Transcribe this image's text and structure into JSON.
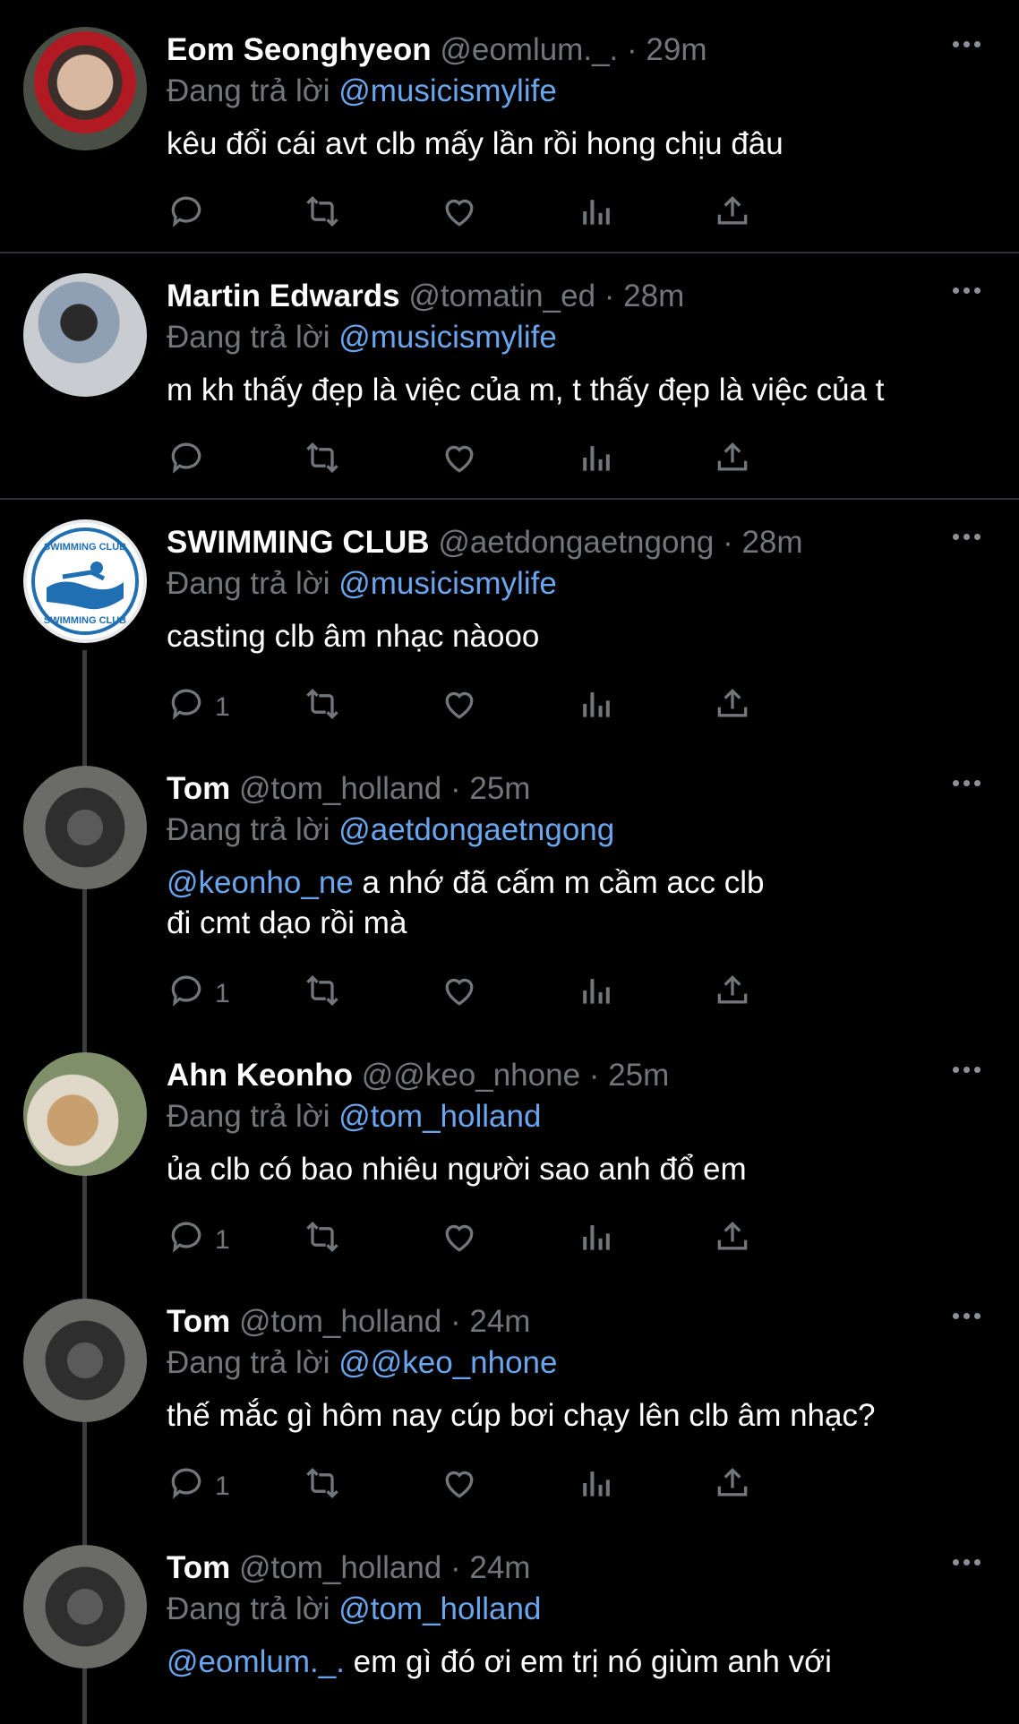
{
  "reply_prefix": "Đang trả lời",
  "tweets": [
    {
      "name": "Eom Seonghyeon",
      "handle": "@eomlum._.",
      "time": "29m",
      "reply_to": "@musicismylife",
      "body_mention": "",
      "body": "kêu đổi cái avt clb mấy lần rồi hong chịu đâu",
      "reply_count": ""
    },
    {
      "name": "Martin Edwards",
      "handle": "@tomatin_ed",
      "time": "28m",
      "reply_to": "@musicismylife",
      "body_mention": "",
      "body": "m kh thấy đẹp là việc của m, t thấy đẹp là việc của t",
      "reply_count": ""
    },
    {
      "name": "SWIMMING CLUB",
      "handle": "@aetdongaetngong",
      "time": "28m",
      "reply_to": "@musicismylife",
      "body_mention": "",
      "body": "casting clb âm nhạc nàooo",
      "reply_count": "1",
      "logo_text": "SWIMMING CLUB"
    },
    {
      "name": "Tom",
      "handle": "@tom_holland",
      "time": "25m",
      "reply_to": "@aetdongaetngong",
      "body_mention": "@keonho_ne",
      "body": " a nhớ đã cấm m cầm acc clb đi cmt dạo rồi mà",
      "reply_count": "1"
    },
    {
      "name": "Ahn Keonho",
      "handle": "@@keo_nhone",
      "time": "25m",
      "reply_to": "@tom_holland",
      "body_mention": "",
      "body": "ủa clb có bao nhiêu người sao anh đổ em",
      "reply_count": "1"
    },
    {
      "name": "Tom",
      "handle": "@tom_holland",
      "time": "24m",
      "reply_to": "@@keo_nhone",
      "body_mention": "",
      "body": "thế mắc gì hôm nay cúp bơi chạy lên clb âm nhạc?",
      "reply_count": "1"
    },
    {
      "name": "Tom",
      "handle": "@tom_holland",
      "time": "24m",
      "reply_to": "@tom_holland",
      "body_mention": "@eomlum._.",
      "body": " em gì đó ơi em trị nó giùm anh với",
      "reply_count": ""
    }
  ],
  "colors": {
    "background": "#000000",
    "text": "#e7e9ea",
    "muted": "#71767b",
    "link": "#6aa6ee",
    "divider": "#2f3336"
  },
  "icons": [
    "comment-icon",
    "retweet-icon",
    "like-icon",
    "views-icon",
    "share-icon",
    "more-icon"
  ]
}
